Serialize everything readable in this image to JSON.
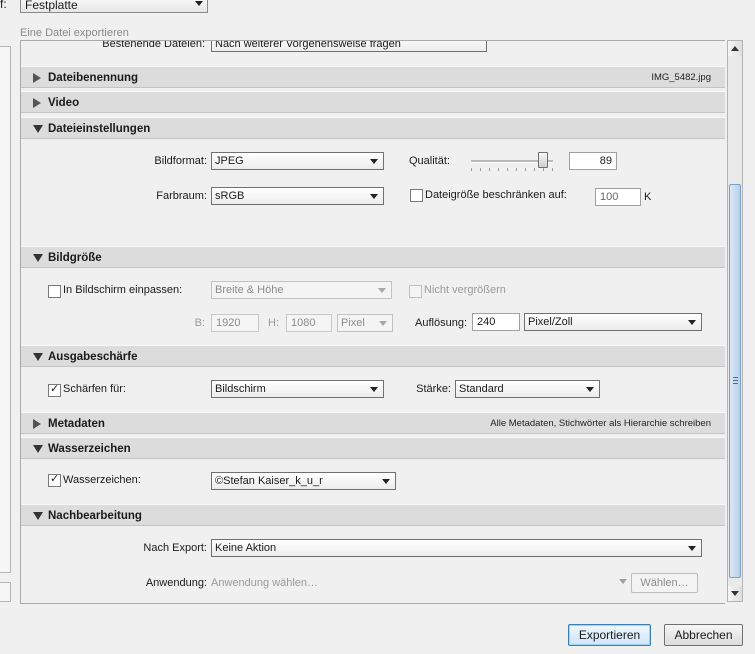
{
  "top": {
    "label_fragment": "f:",
    "dest_value": "Festplatte",
    "subtitle": "Eine Datei exportieren",
    "clipped_row_value": "Nach weiterer Vorgehensweise fragen",
    "clipped_row_label": "Bestehende Dateien:"
  },
  "sections": {
    "naming": {
      "title": "Dateibenennung",
      "note": "IMG_5482.jpg"
    },
    "video": {
      "title": "Video"
    },
    "file_settings": {
      "title": "Dateieinstellungen",
      "format_label": "Bildformat:",
      "format_value": "JPEG",
      "quality_label": "Qualität:",
      "quality_value": "89",
      "quality_percent": 89,
      "colorspace_label": "Farbraum:",
      "colorspace_value": "sRGB",
      "limit_label": "Dateigröße beschränken auf:",
      "limit_value": "100",
      "limit_unit": "K"
    },
    "image_size": {
      "title": "Bildgröße",
      "fit_label": "In Bildschirm einpassen:",
      "fit_value": "Breite & Höhe",
      "no_enlarge_label": "Nicht vergrößern",
      "w_label": "B:",
      "w_value": "1920",
      "h_label": "H:",
      "h_value": "1080",
      "unit_value": "Pixel",
      "res_label": "Auflösung:",
      "res_value": "240",
      "res_unit": "Pixel/Zoll"
    },
    "sharpening": {
      "title": "Ausgabeschärfe",
      "sharpen_label": "Schärfen für:",
      "sharpen_value": "Bildschirm",
      "amount_label": "Stärke:",
      "amount_value": "Standard"
    },
    "metadata": {
      "title": "Metadaten",
      "note": "Alle Metadaten, Stichwörter als Hierarchie schreiben"
    },
    "watermark": {
      "title": "Wasserzeichen",
      "wm_label": "Wasserzeichen:",
      "wm_value": "©Stefan Kaiser_k_u_r"
    },
    "post": {
      "title": "Nachbearbeitung",
      "after_label": "Nach Export:",
      "after_value": "Keine Aktion",
      "app_label": "Anwendung:",
      "app_placeholder": "Anwendung wählen…",
      "choose_label": "Wählen…"
    }
  },
  "buttons": {
    "export": "Exportieren",
    "cancel": "Abbrechen"
  },
  "checks": {
    "limit": false,
    "fit": false,
    "no_enlarge": false,
    "sharpen": true,
    "watermark": true
  },
  "colors": {
    "header": "#dcdcdc",
    "panel": "#f0f0f0",
    "primary_border": "#3c7fb1"
  }
}
